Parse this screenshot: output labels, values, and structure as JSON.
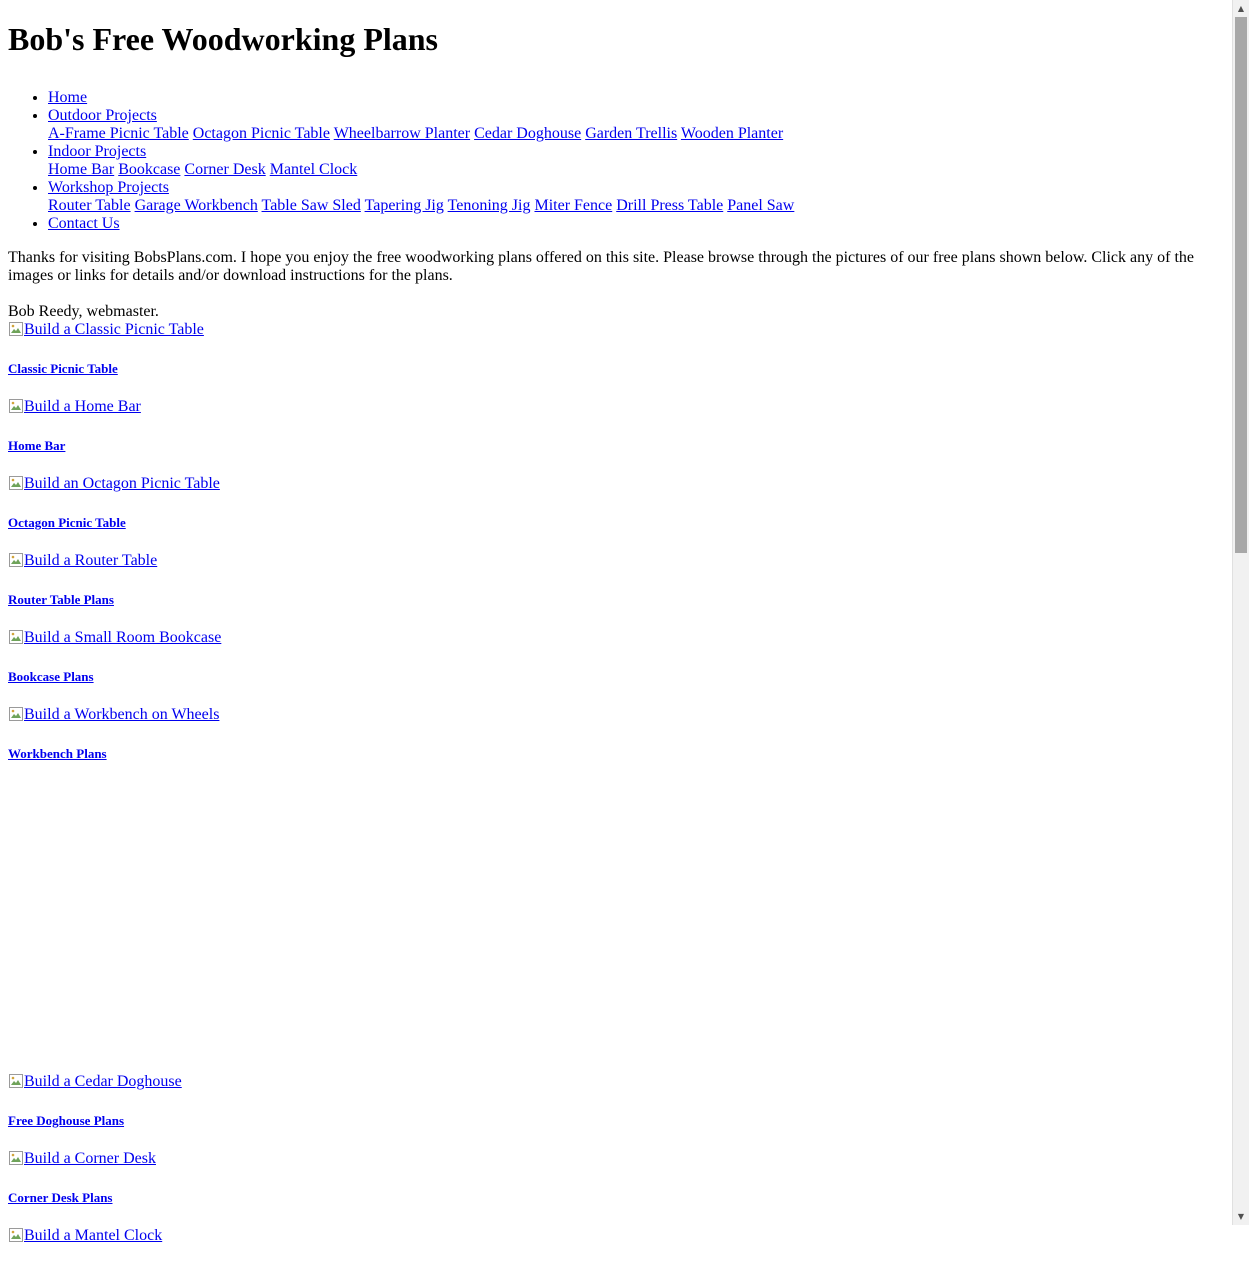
{
  "site": {
    "title": "Bob's Free Woodworking Plans"
  },
  "nav": {
    "home": "Home",
    "outdoor": {
      "label": "Outdoor Projects",
      "items": [
        "A-Frame Picnic Table",
        "Octagon Picnic Table",
        "Wheelbarrow Planter",
        "Cedar Doghouse",
        "Garden Trellis",
        "Wooden Planter"
      ]
    },
    "indoor": {
      "label": "Indoor Projects",
      "items": [
        "Home Bar",
        "Bookcase",
        "Corner Desk",
        "Mantel Clock"
      ]
    },
    "workshop": {
      "label": "Workshop Projects",
      "items": [
        "Router Table",
        "Garage Workbench",
        "Table Saw Sled",
        "Tapering Jig",
        "Tenoning Jig",
        "Miter Fence",
        "Drill Press Table",
        "Panel Saw"
      ]
    },
    "contact": "Contact Us"
  },
  "intro": {
    "text": "Thanks for visiting BobsPlans.com. I hope you enjoy the free woodworking plans offered on this site. Please browse through the pictures of our free plans shown below. Click any of the images or links for details and/or download instructions for the plans.",
    "signature": "Bob Reedy, webmaster."
  },
  "plans": [
    {
      "alt": "Build a Classic Picnic Table",
      "caption": "Classic Picnic Table"
    },
    {
      "alt": "Build a Home Bar",
      "caption": "Home Bar"
    },
    {
      "alt": "Build an Octagon Picnic Table",
      "caption": "Octagon Picnic Table"
    },
    {
      "alt": "Build a Router Table",
      "caption": "Router Table Plans"
    },
    {
      "alt": "Build a Small Room Bookcase",
      "caption": "Bookcase Plans"
    },
    {
      "alt": "Build a Workbench on Wheels",
      "caption": "Workbench Plans"
    }
  ],
  "plans_after": [
    {
      "alt": "Build a Cedar Doghouse",
      "caption": "Free Doghouse Plans"
    },
    {
      "alt": "Build a Corner Desk",
      "caption": "Corner Desk Plans"
    },
    {
      "alt": "Build a Mantel Clock",
      "caption": ""
    }
  ],
  "colors": {
    "link": "#0000ee",
    "text": "#000000",
    "background": "#ffffff",
    "scrollbar_track": "#f1f1f1",
    "scrollbar_thumb": "#a8a8a8"
  }
}
